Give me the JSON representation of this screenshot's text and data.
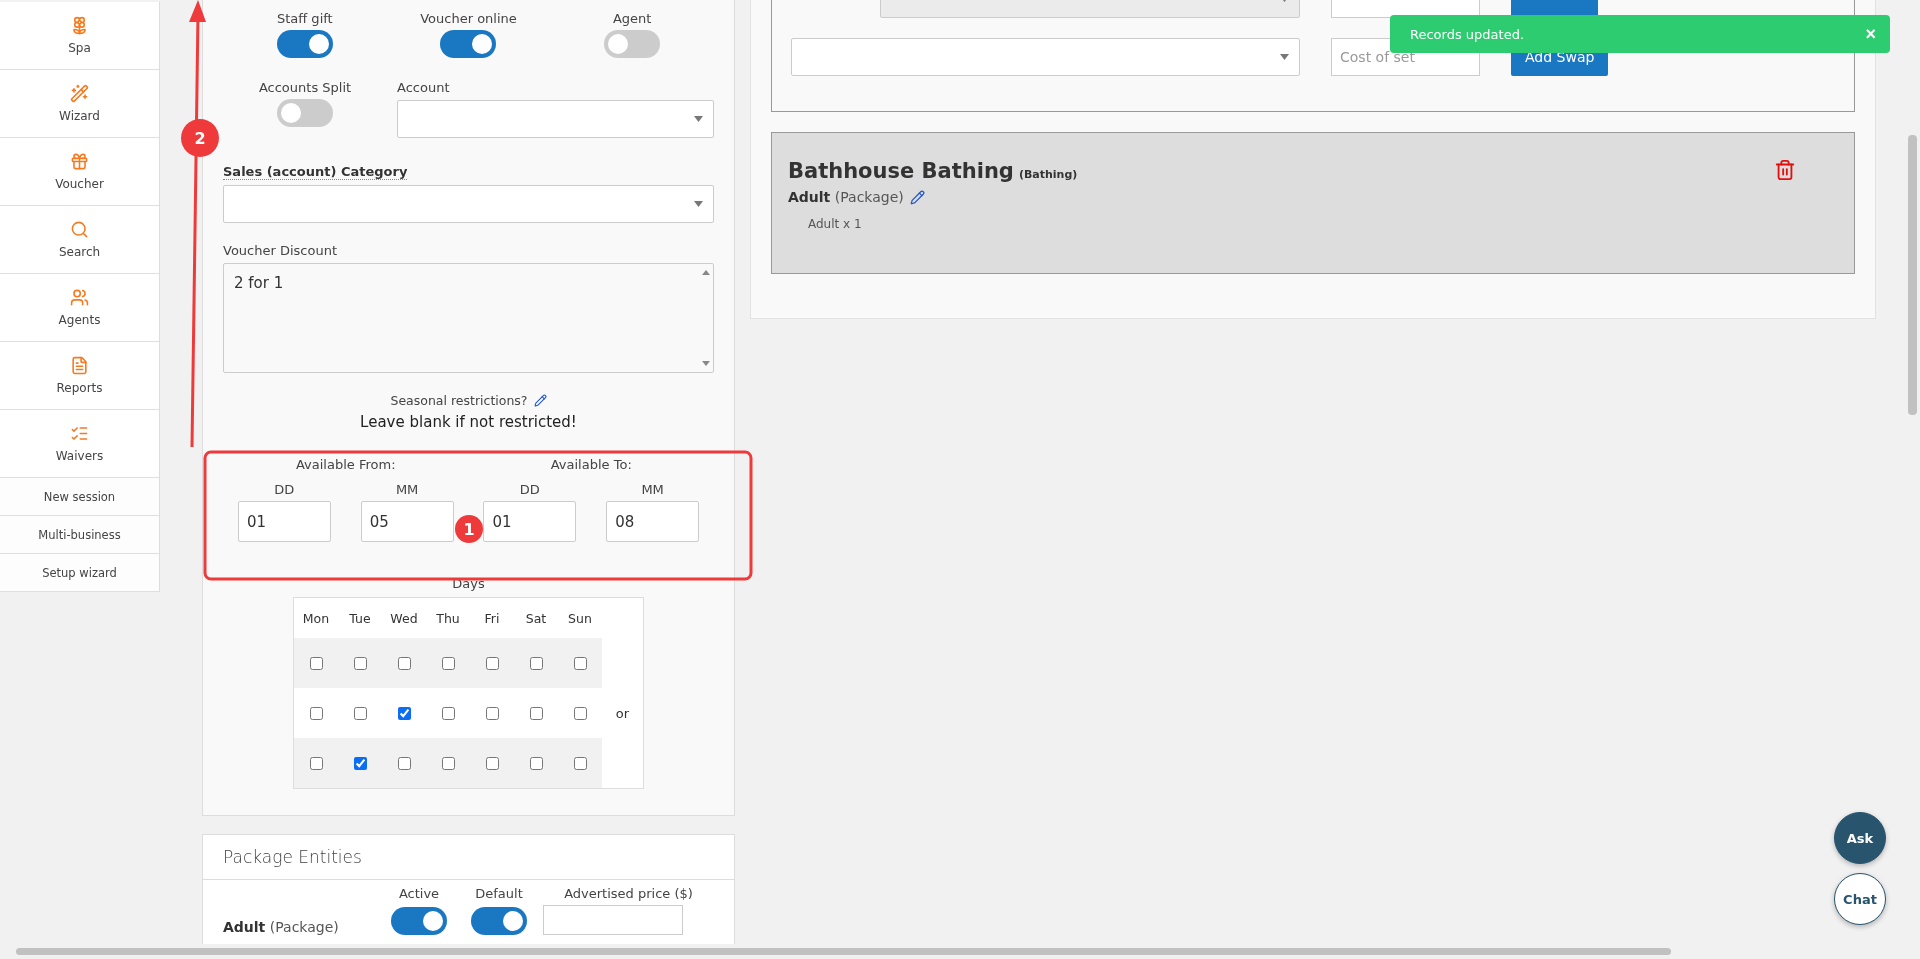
{
  "sidebar": {
    "items": [
      {
        "kind": "tile",
        "label": "Spa"
      },
      {
        "kind": "tile",
        "label": "Wizard"
      },
      {
        "kind": "tile",
        "label": "Voucher"
      },
      {
        "kind": "tile",
        "label": "Search"
      },
      {
        "kind": "tile",
        "label": "Agents"
      },
      {
        "kind": "tile",
        "label": "Reports"
      },
      {
        "kind": "tile",
        "label": "Waivers"
      },
      {
        "kind": "link",
        "label": "New session"
      },
      {
        "kind": "link",
        "label": "Multi-business"
      },
      {
        "kind": "link",
        "label": "Setup wizard"
      }
    ]
  },
  "settings": {
    "toggles": [
      {
        "label": "Staff gift",
        "on": true
      },
      {
        "label": "Voucher online",
        "on": true
      },
      {
        "label": "Agent",
        "on": false
      }
    ],
    "accounts_split": {
      "label": "Accounts Split",
      "on": false
    },
    "account": {
      "label": "Account"
    },
    "sales_category": {
      "label": "Sales (account) Category"
    },
    "voucher_discount": {
      "label": "Voucher Discount",
      "value": "2 for 1"
    },
    "seasonal": {
      "label": "Seasonal restrictions?",
      "hint": "Leave blank if not restricted!"
    },
    "availability": [
      {
        "label": "Available From:",
        "fields": [
          {
            "label": "DD",
            "value": "01"
          },
          {
            "label": "MM",
            "value": "05"
          }
        ]
      },
      {
        "label": "Available To:",
        "fields": [
          {
            "label": "DD",
            "value": "01"
          },
          {
            "label": "MM",
            "value": "08"
          }
        ]
      }
    ],
    "days": {
      "label": "Days",
      "columns": [
        "Mon",
        "Tue",
        "Wed",
        "Thu",
        "Fri",
        "Sat",
        "Sun"
      ],
      "or": "or",
      "rows": [
        {
          "cells": [
            {
              "checked": false
            },
            {
              "checked": false
            },
            {
              "checked": false
            },
            {
              "checked": false
            },
            {
              "checked": false
            },
            {
              "checked": false
            },
            {
              "checked": false
            }
          ]
        },
        {
          "cells": [
            {
              "checked": false
            },
            {
              "checked": false
            },
            {
              "checked": true
            },
            {
              "checked": false
            },
            {
              "checked": false
            },
            {
              "checked": false
            },
            {
              "checked": false
            }
          ]
        },
        {
          "cells": [
            {
              "checked": false
            },
            {
              "checked": true
            },
            {
              "checked": false
            },
            {
              "checked": false
            },
            {
              "checked": false
            },
            {
              "checked": false
            },
            {
              "checked": false
            }
          ]
        }
      ]
    }
  },
  "package_entities": {
    "title": "Package Entities",
    "columns": [
      "Active",
      "Default",
      "Advertised price ($)"
    ],
    "rows": [
      {
        "name": "Adult",
        "type": "(Package)",
        "active": true,
        "default": true
      }
    ]
  },
  "swaps": [
    {
      "disabled": true
    },
    {
      "cost_placeholder": "Cost of set",
      "button": "Add Swap",
      "disabled": false
    }
  ],
  "package": {
    "name": "Bathhouse Bathing",
    "category": "(Bathing)",
    "entity": "Adult",
    "entity_type": "(Package)",
    "line": "Adult x 1"
  },
  "toast": {
    "message": "Records updated.",
    "close": "×"
  },
  "help": {
    "ask": "Ask",
    "chat": "Chat"
  },
  "annotations": {
    "markers": [
      "1",
      "2"
    ]
  }
}
